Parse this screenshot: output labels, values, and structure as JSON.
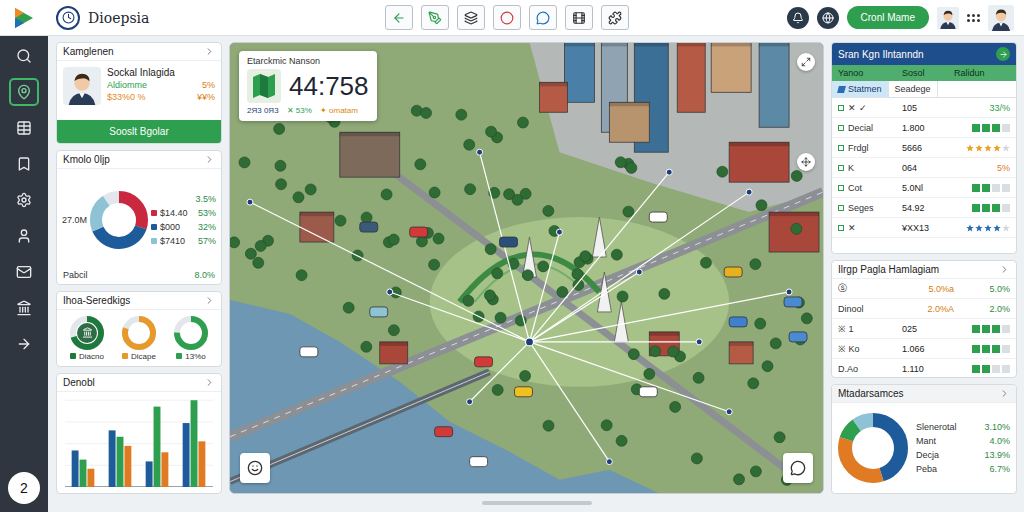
{
  "app": {
    "title": "Dioepsia",
    "action_button": "Cronl Mame",
    "sidebar_badge": "2"
  },
  "sidebar": {
    "items": [
      {
        "selected": false
      },
      {
        "selected": true
      },
      {
        "selected": false
      },
      {
        "selected": false
      },
      {
        "selected": false
      },
      {
        "selected": false
      },
      {
        "selected": false
      },
      {
        "selected": false
      },
      {
        "selected": false
      }
    ]
  },
  "profile_card": {
    "title": "Kamglenen",
    "name": "Sockal Inlagida",
    "stats": [
      {
        "label": "Aldiomme",
        "value": "5%",
        "color": "#2e9e4f"
      },
      {
        "label": "$33%0 %",
        "value": "¥¥%",
        "color": "#e08a1e"
      }
    ],
    "button": "Sooslt Bgolar"
  },
  "revenue_card": {
    "title": "Kmolo 0ljp",
    "total": "27.0M",
    "top": "3.5%",
    "segments": [
      {
        "value": "$14.40",
        "pct": "53%",
        "color": "#c9283e",
        "level": 0.3
      },
      {
        "value": "$000",
        "pct": "32%",
        "color": "#1e5b9a",
        "level": 0.38
      },
      {
        "value": "$7410",
        "pct": "57%",
        "color": "#8ec3d6",
        "level": 0.22
      }
    ],
    "footer": {
      "label": "Pabcil",
      "value": "8.0%"
    }
  },
  "rings_card": {
    "title": "Ihoa-Seredkigs",
    "rings": [
      {
        "label": "Diacno",
        "level": 0.7,
        "color": "#1e7a3c"
      },
      {
        "label": "Dicape",
        "level": 0.8,
        "color": "#e59a2a"
      },
      {
        "label": "13%o",
        "level": 0.75,
        "color": "#2e9e4f"
      }
    ]
  },
  "bar_card": {
    "title": "Denobl",
    "series": [
      {
        "color": "#1e5b9a",
        "values": [
          40,
          62,
          28,
          70
        ]
      },
      {
        "color": "#2e9e4f",
        "values": [
          30,
          55,
          88,
          95
        ]
      },
      {
        "color": "#e07b24",
        "values": [
          20,
          45,
          38,
          50
        ]
      }
    ]
  },
  "map": {
    "overlay": {
      "title": "Etarckmic Nanson",
      "value": "44:758",
      "stats": [
        {
          "text": "2Я3 0Я3",
          "color": "#1e3f7a"
        },
        {
          "text": "✕ 53%",
          "color": "#2e9e4f"
        },
        {
          "text": "✦ omatam",
          "color": "#d98a10"
        }
      ]
    }
  },
  "stats_panel": {
    "title": "Sran Kgn Ilntanndn",
    "columns": [
      "Yanoo",
      "Sosol",
      "Ralidun"
    ],
    "tabs": [
      {
        "label": "Statmen",
        "selected": true
      },
      {
        "label": "Seadege",
        "selected": false
      }
    ],
    "rows": [
      {
        "label": "✕ ✓",
        "value": "105",
        "kind": "percent",
        "reading": "33/%",
        "color": "#2e9e4f"
      },
      {
        "label": "Decial",
        "value": "1.800",
        "kind": "blocks",
        "level": 0.75
      },
      {
        "label": "Frdgl",
        "value": "5666",
        "kind": "stars",
        "stars": 4,
        "color": "#e8a020"
      },
      {
        "label": "K",
        "value": "064",
        "kind": "percent",
        "reading": "5%",
        "color": "#e07b24"
      },
      {
        "label": "Cot",
        "value": "5.0Nl",
        "kind": "blocks",
        "level": 0.5
      },
      {
        "label": "Seges",
        "value": "54.92",
        "kind": "blocks",
        "level": 0.75
      },
      {
        "label": "✕",
        "value": "¥XX13",
        "kind": "stars",
        "stars": 4,
        "color": "#2a6db5"
      }
    ]
  },
  "pages_panel": {
    "title": "Ilrgp Pagla Hamlagiam",
    "rows": [
      {
        "kind": "pair",
        "label": "ⓢ",
        "a": "5.0%a",
        "b": "5.0%"
      },
      {
        "kind": "pair",
        "label": "Dinool",
        "a": "2.0%A",
        "b": "2.0%"
      },
      {
        "kind": "blocks",
        "label": "※ 1",
        "value": "025",
        "level": 0.75
      },
      {
        "kind": "blocks",
        "label": "※ Ko",
        "value": "1.066",
        "level": 0.75
      },
      {
        "kind": "blocks",
        "label": "D.Ao",
        "value": "1.110",
        "level": 0.5
      }
    ]
  },
  "measures_panel": {
    "title": "Mtadarsamces",
    "items": [
      {
        "label": "Slenerotal",
        "value": "3.10%",
        "color": "#1e5b9a",
        "level": 0.45
      },
      {
        "label": "Mant",
        "value": "4.0%",
        "color": "#e07b24",
        "level": 0.35
      },
      {
        "label": "Decja",
        "value": "13.9%",
        "color": "#2e9e4f",
        "level": 0.1
      },
      {
        "label": "Peba",
        "value": "6.7%",
        "color": "#8ec3d6",
        "level": 0.1
      }
    ]
  }
}
